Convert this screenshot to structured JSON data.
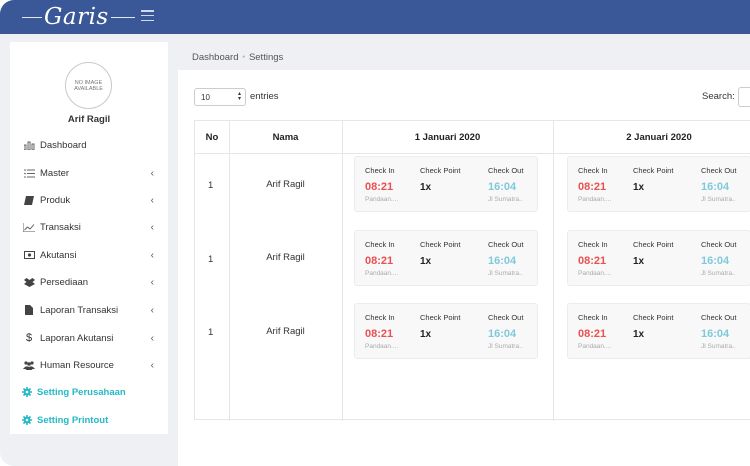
{
  "app": {
    "brand": "Garis"
  },
  "profile": {
    "avatar_text": "NO IMAGE AVAILABLE",
    "name": "Arif Ragil"
  },
  "sidebar": {
    "items": [
      {
        "label": "Dashboard",
        "icon": "bar-chart-icon",
        "has_arrow": false,
        "active": false
      },
      {
        "label": "Master",
        "icon": "list-icon",
        "has_arrow": true,
        "active": false
      },
      {
        "label": "Produk",
        "icon": "book-icon",
        "has_arrow": true,
        "active": false
      },
      {
        "label": "Transaksi",
        "icon": "line-chart-icon",
        "has_arrow": true,
        "active": false
      },
      {
        "label": "Akutansi",
        "icon": "money-icon",
        "has_arrow": true,
        "active": false
      },
      {
        "label": "Persediaan",
        "icon": "boxes-icon",
        "has_arrow": true,
        "active": false
      },
      {
        "label": "Laporan Transaksi",
        "icon": "file-icon",
        "has_arrow": true,
        "active": false
      },
      {
        "label": "Laporan Akutansi",
        "icon": "dollar-icon",
        "has_arrow": true,
        "active": false
      },
      {
        "label": "Human Resource",
        "icon": "users-icon",
        "has_arrow": true,
        "active": false
      },
      {
        "label": "Setting Perusahaan",
        "icon": "gear-icon",
        "has_arrow": false,
        "active": true
      },
      {
        "label": "Setting Printout",
        "icon": "gear-icon",
        "has_arrow": false,
        "active": true
      }
    ],
    "arrow": "‹"
  },
  "breadcrumb": {
    "home": "Dashboard",
    "sep": "•",
    "current": "Settings"
  },
  "table_controls": {
    "length_value": "10",
    "length_suffix": "entries",
    "search_label": "Search:"
  },
  "table": {
    "headers": {
      "no": "No",
      "nama": "Nama",
      "dates": [
        "1 Januari 2020",
        "2 Januari 2020"
      ]
    },
    "card_labels": {
      "check_in": "Check In",
      "check_point": "Check Point",
      "check_out": "Check Out"
    },
    "rows": [
      {
        "no": "1",
        "nama": "Arif Ragil",
        "days": [
          {
            "check_in": "08:21",
            "check_point": "1x",
            "check_out": "16:04",
            "in_location": "Pandaan....",
            "out_location": "Jl Sumatra.."
          },
          {
            "check_in": "08:21",
            "check_point": "1x",
            "check_out": "16:04",
            "in_location": "Pandaan....",
            "out_location": "Jl Sumatra.."
          }
        ]
      },
      {
        "no": "1",
        "nama": "Arif Ragil",
        "days": [
          {
            "check_in": "08:21",
            "check_point": "1x",
            "check_out": "16:04",
            "in_location": "Pandaan....",
            "out_location": "Jl Sumatra.."
          },
          {
            "check_in": "08:21",
            "check_point": "1x",
            "check_out": "16:04",
            "in_location": "Pandaan....",
            "out_location": "Jl Sumatra.."
          }
        ]
      },
      {
        "no": "1",
        "nama": "Arif Ragil",
        "days": [
          {
            "check_in": "08:21",
            "check_point": "1x",
            "check_out": "16:04",
            "in_location": "Pandaan....",
            "out_location": "Jl Sumatra.."
          },
          {
            "check_in": "08:21",
            "check_point": "1x",
            "check_out": "16:04",
            "in_location": "Pandaan....",
            "out_location": "Jl Sumatra.."
          }
        ]
      }
    ]
  },
  "colors": {
    "topbar": "#3a5897",
    "accent": "#24b9c7",
    "check_in": "#e8514f",
    "check_out": "#7fc9da"
  }
}
